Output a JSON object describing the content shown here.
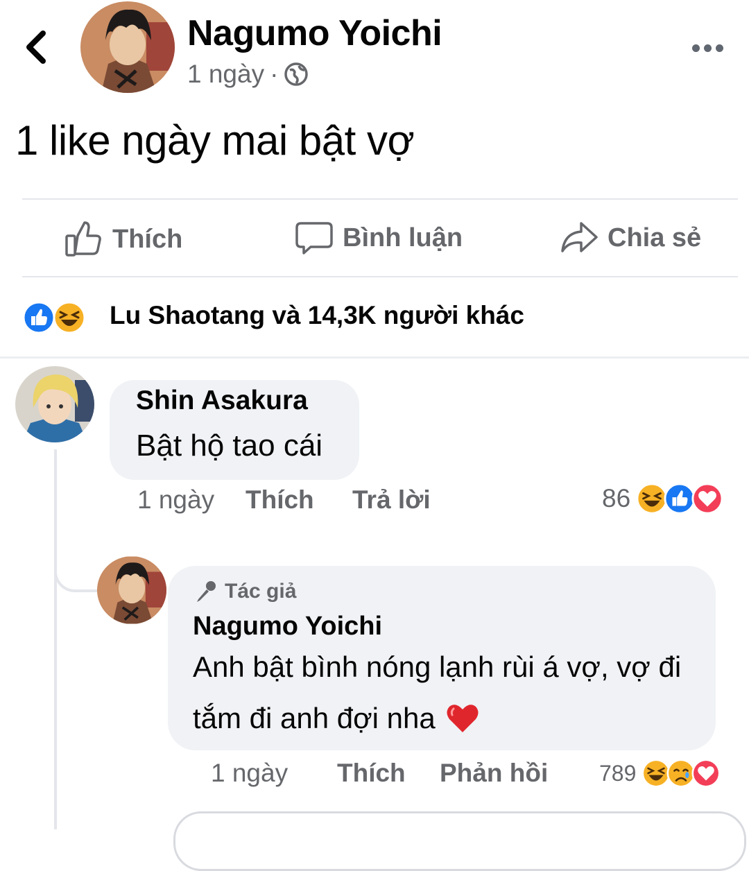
{
  "header": {
    "author_name": "Nagumo Yoichi",
    "time": "1 ngày",
    "meta_dot": "·",
    "privacy_icon": "globe-icon"
  },
  "post": {
    "text": "1 like ngày mai bật vợ"
  },
  "actions": {
    "like_label": "Thích",
    "comment_label": "Bình luận",
    "share_label": "Chia sẻ"
  },
  "reactions": {
    "icons": [
      "like-icon",
      "haha-icon"
    ],
    "name": "Lu Shaotang",
    "rest": " và 14,3K người khác"
  },
  "comments": [
    {
      "name": "Shin Asakura",
      "text": "Bật hộ tao cái",
      "time": "1 ngày",
      "like_label": "Thích",
      "reply_label": "Trả lời",
      "reaction_count": "86",
      "reaction_icons": [
        "haha-icon",
        "like-icon",
        "love-icon"
      ]
    },
    {
      "badge": "Tác giả",
      "name": "Nagumo Yoichi",
      "line1": "Anh bật bình nóng lạnh rùi á vợ, vợ đi",
      "line2": "tắm đi anh đợi nha",
      "time": "1 ngày",
      "like_label": "Thích",
      "reply_label": "Phản hồi",
      "reaction_count": "789",
      "reaction_icons": [
        "haha-icon",
        "sad-icon",
        "love-icon"
      ]
    }
  ],
  "colors": {
    "like_blue": "#1877f2",
    "haha_yellow": "#f7b125",
    "love_red": "#f33e58",
    "text_secondary": "#65676b"
  }
}
